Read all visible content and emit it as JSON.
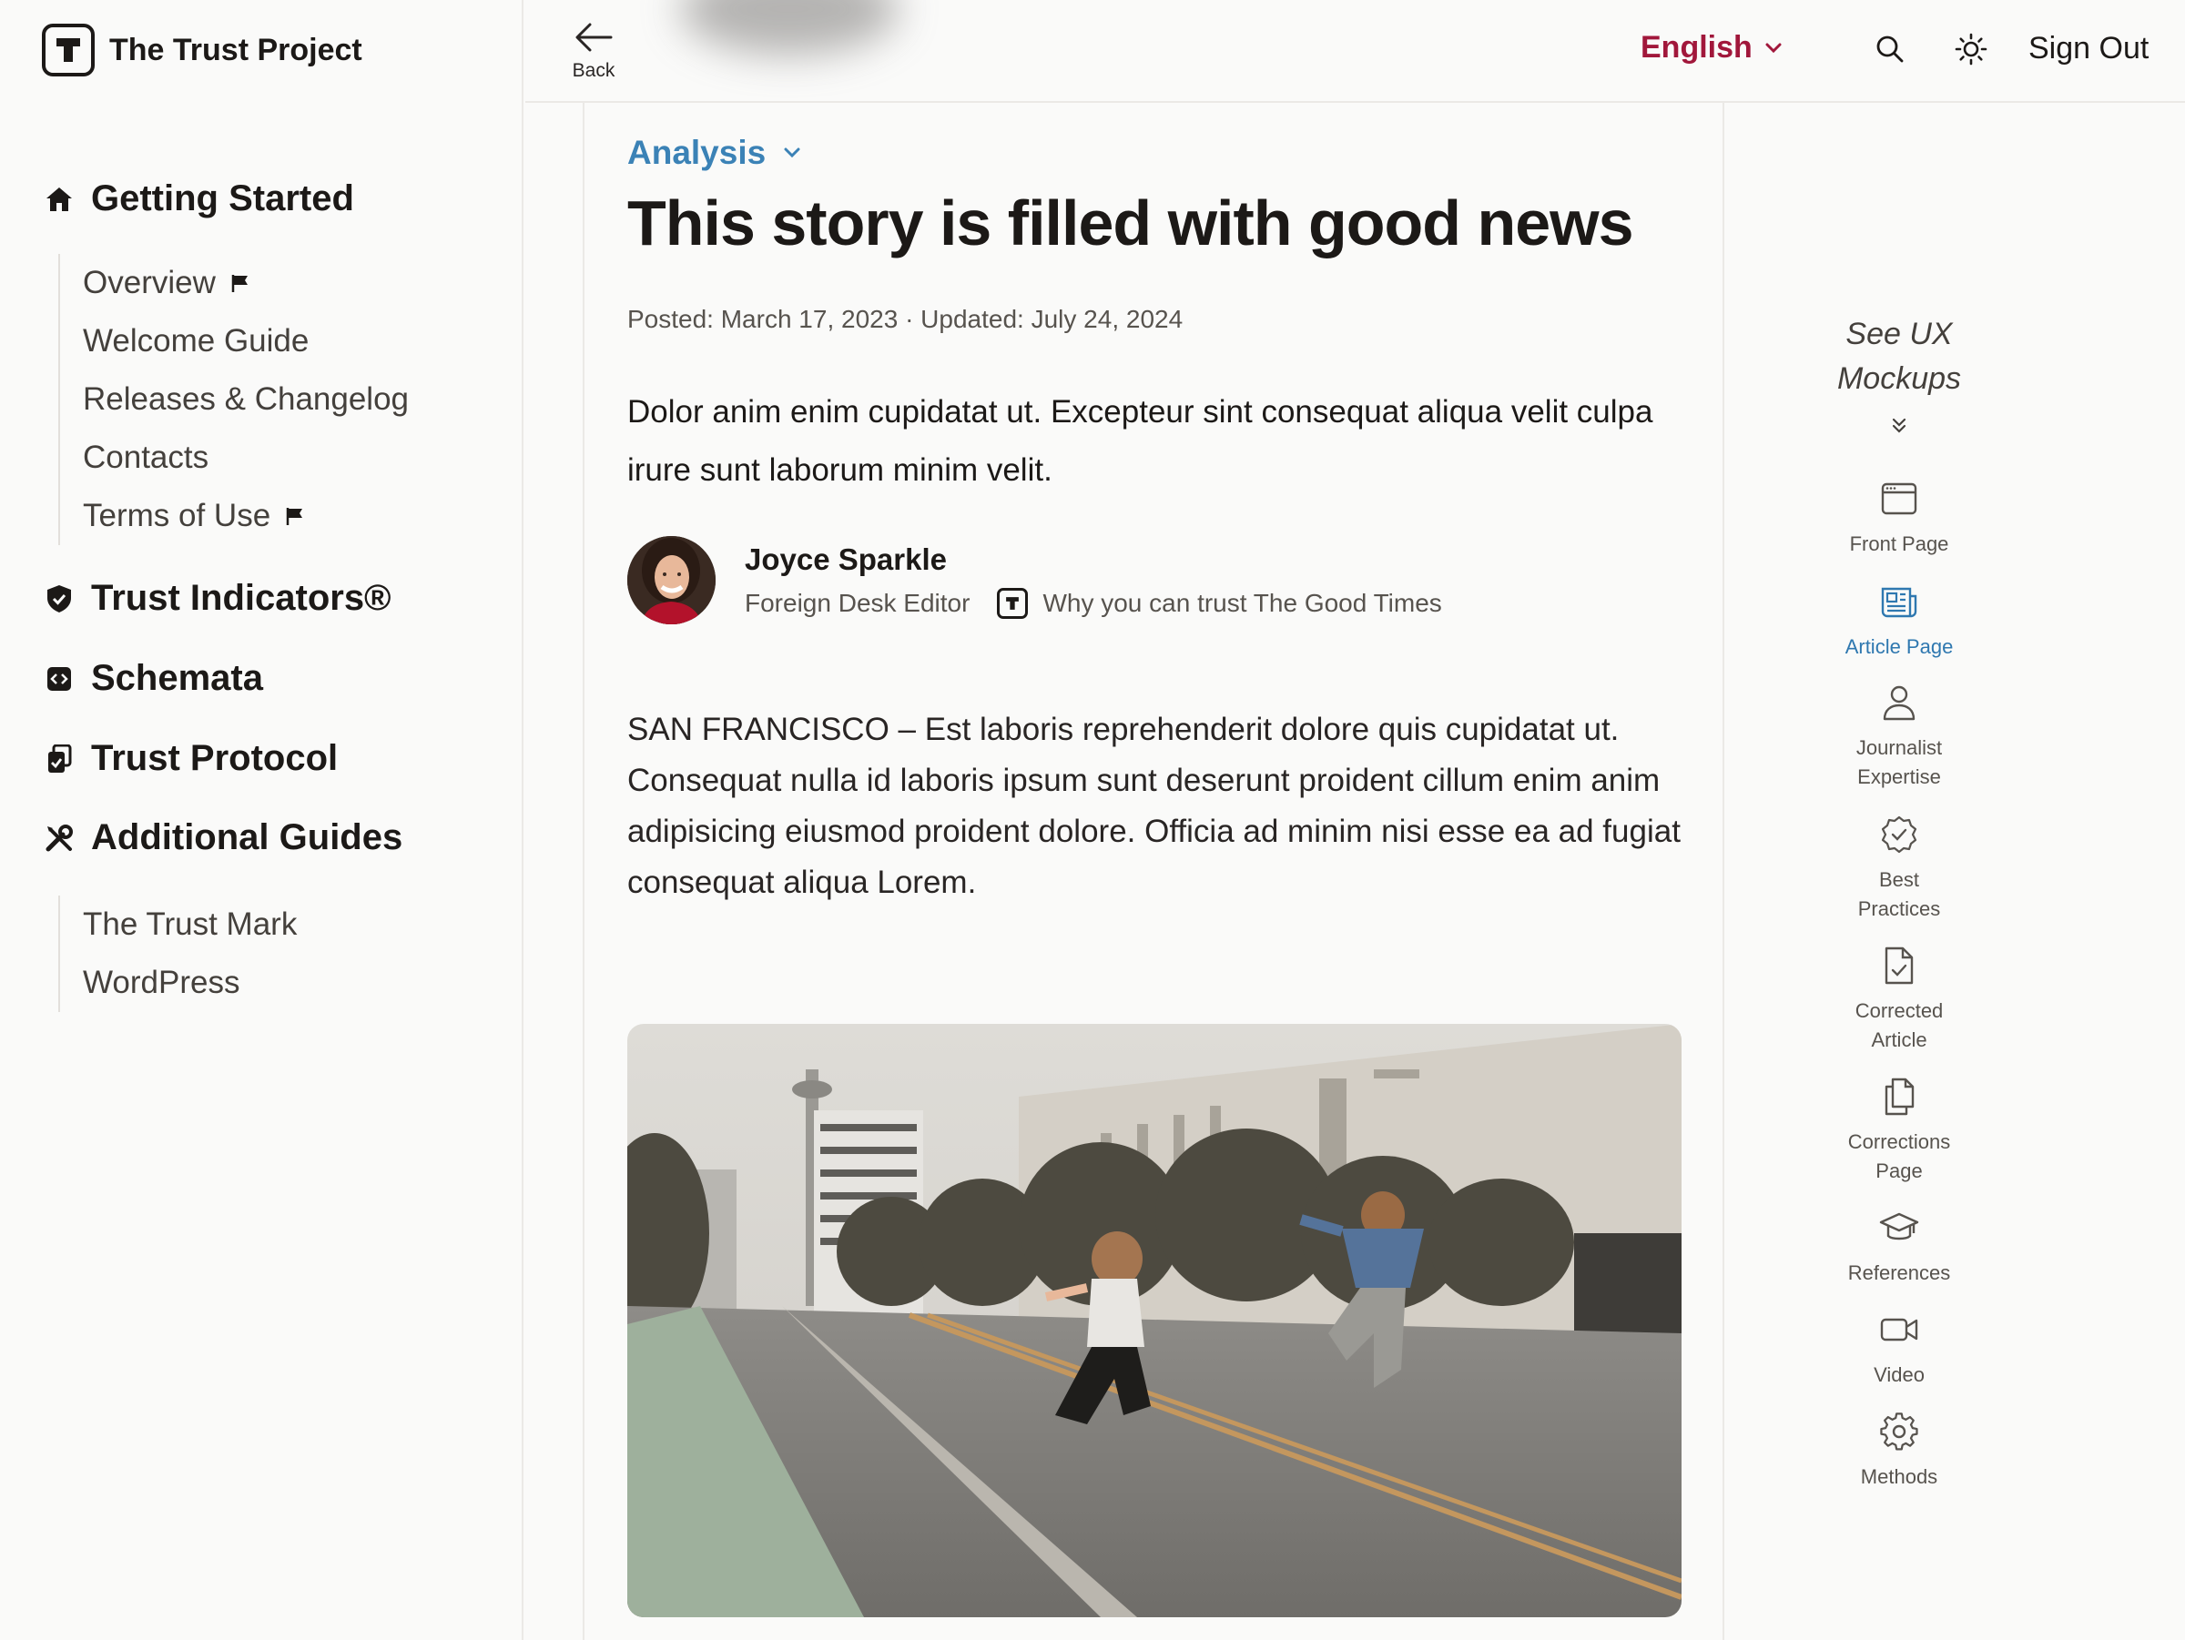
{
  "brand": {
    "name": "The Trust Project",
    "logo_letter": "T"
  },
  "sidebar": {
    "sections": [
      {
        "label": "Getting Started",
        "icon": "home-icon",
        "items": [
          {
            "label": "Overview",
            "flag": true
          },
          {
            "label": "Welcome Guide",
            "flag": false
          },
          {
            "label": "Releases & Changelog",
            "flag": false
          },
          {
            "label": "Contacts",
            "flag": false
          },
          {
            "label": "Terms of Use",
            "flag": true
          }
        ]
      },
      {
        "label": "Trust Indicators®",
        "icon": "shield-check-icon",
        "items": []
      },
      {
        "label": "Schemata",
        "icon": "code-icon",
        "items": []
      },
      {
        "label": "Trust Protocol",
        "icon": "clipboard-check-icon",
        "items": []
      },
      {
        "label": "Additional Guides",
        "icon": "tools-icon",
        "items": [
          {
            "label": "The Trust Mark",
            "flag": false
          },
          {
            "label": "WordPress",
            "flag": false
          }
        ]
      }
    ]
  },
  "topbar": {
    "back_label": "Back",
    "language": "English",
    "sign_out": "Sign Out"
  },
  "article": {
    "category": "Analysis",
    "headline": "This story is filled with good news",
    "dates": "Posted: March 17, 2023 · Updated: July 24, 2024",
    "lede": "Dolor anim enim cupidatat ut. Excepteur sint consequat aliqua velit culpa irure sunt laborum minim velit.",
    "author": {
      "name": "Joyce Sparkle",
      "role": "Foreign Desk Editor",
      "trust_link": "Why you can trust The Good Times"
    },
    "body": "SAN FRANCISCO – Est laboris reprehenderit dolore quis cupidatat ut. Consequat nulla id laboris ipsum sunt deserunt proident cillum enim anim adipisicing eiusmod proident dolore. Officia ad minim nisi esse ea ad fugiat consequat aliqua Lorem."
  },
  "rail": {
    "heading_line1": "See UX",
    "heading_line2": "Mockups",
    "items": [
      {
        "line1": "Front Page",
        "line2": "",
        "icon": "browser-window-icon",
        "active": false
      },
      {
        "line1": "Article Page",
        "line2": "",
        "icon": "newspaper-icon",
        "active": true
      },
      {
        "line1": "Journalist",
        "line2": "Expertise",
        "icon": "user-icon",
        "active": false
      },
      {
        "line1": "Best",
        "line2": "Practices",
        "icon": "badge-check-icon",
        "active": false
      },
      {
        "line1": "Corrected",
        "line2": "Article",
        "icon": "document-check-icon",
        "active": false
      },
      {
        "line1": "Corrections",
        "line2": "Page",
        "icon": "documents-icon",
        "active": false
      },
      {
        "line1": "References",
        "line2": "",
        "icon": "graduation-cap-icon",
        "active": false
      },
      {
        "line1": "Video",
        "line2": "",
        "icon": "video-camera-icon",
        "active": false
      },
      {
        "line1": "Methods",
        "line2": "",
        "icon": "gear-icon",
        "active": false
      }
    ]
  },
  "colors": {
    "accent_red": "#a1173b",
    "accent_blue": "#3b82b6",
    "active_rail": "#2f78b0"
  }
}
